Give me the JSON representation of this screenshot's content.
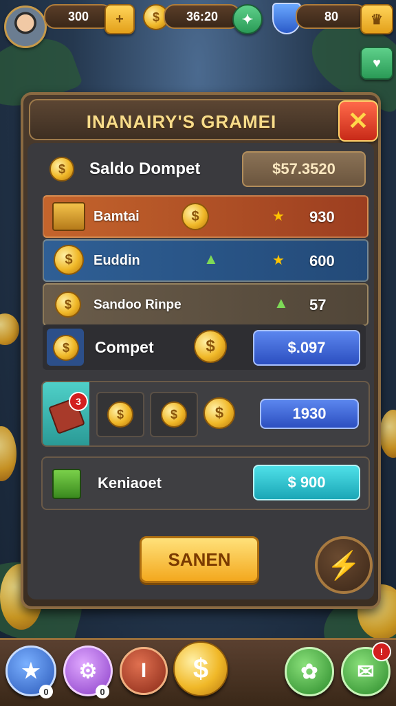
{
  "hud": {
    "gold_value": "300",
    "gold_add_label": "+",
    "coins_value": "36:20",
    "coins_add_label": "✦",
    "shield_value": "80",
    "crown_icon": "crown-icon",
    "gift_icon": "gem-heart-icon"
  },
  "panel": {
    "title": "INANAIRY'S GRAMEI",
    "close_label": "✕",
    "balance_label": "Saldo Dompet",
    "balance_value": "$57.3520"
  },
  "rows": [
    {
      "label": "Bamtai",
      "value": "930",
      "color": "#b9552b"
    },
    {
      "label": "Euddin",
      "value": "600",
      "color": "#2a5a8a"
    },
    {
      "label": "Sandoo Rinpe",
      "value": "57",
      "color": "#5f5445"
    }
  ],
  "compet": {
    "label": "Compet",
    "button_label": "$.097"
  },
  "bundle": {
    "badge": "3",
    "button_label": "1930"
  },
  "kenia": {
    "label": "Keniaoet",
    "button_label": "$ 900"
  },
  "actions": {
    "saved_label": "SANEN",
    "bolt_label": "⚡"
  },
  "bottom_nav": {
    "star_badge": "0",
    "gear_badge": "0",
    "bell_badge": "!"
  }
}
